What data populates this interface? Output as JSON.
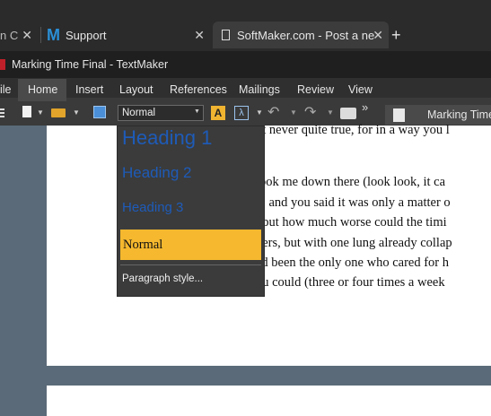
{
  "browser": {
    "tabs": [
      {
        "label": "n C",
        "close": "✕"
      },
      {
        "label": "Support",
        "icon": "M",
        "close": "✕"
      },
      {
        "label": "SoftMaker.com - Post a ne",
        "close": "✕"
      }
    ],
    "new_tab": "+"
  },
  "app": {
    "title": "Marking Time Final - TextMaker"
  },
  "ribbon": {
    "tabs": [
      "ile",
      "Home",
      "Insert",
      "Layout",
      "References",
      "Mailings",
      "Review",
      "View"
    ]
  },
  "toolbar": {
    "style_value": "Normal",
    "more": "»",
    "document_tab": "Marking Time"
  },
  "style_dropdown": {
    "items": [
      "Heading 1",
      "Heading 2",
      "Heading 3",
      "Normal"
    ],
    "selected": "Normal",
    "footer": "Paragraph style..."
  },
  "document": {
    "lines": [
      "ut never quite true, for in a way you l",
      "took me down there  (look look, it ca",
      "n, and you said it was only a matter o",
      ", but how much worse could the timi",
      "hers, but with one lung already collap",
      "ad been the only one who cared for h",
      "ou could  (three or four times a week"
    ]
  },
  "colors": {
    "highlight": "#f5b82e",
    "heading": "#1e5bb8"
  }
}
